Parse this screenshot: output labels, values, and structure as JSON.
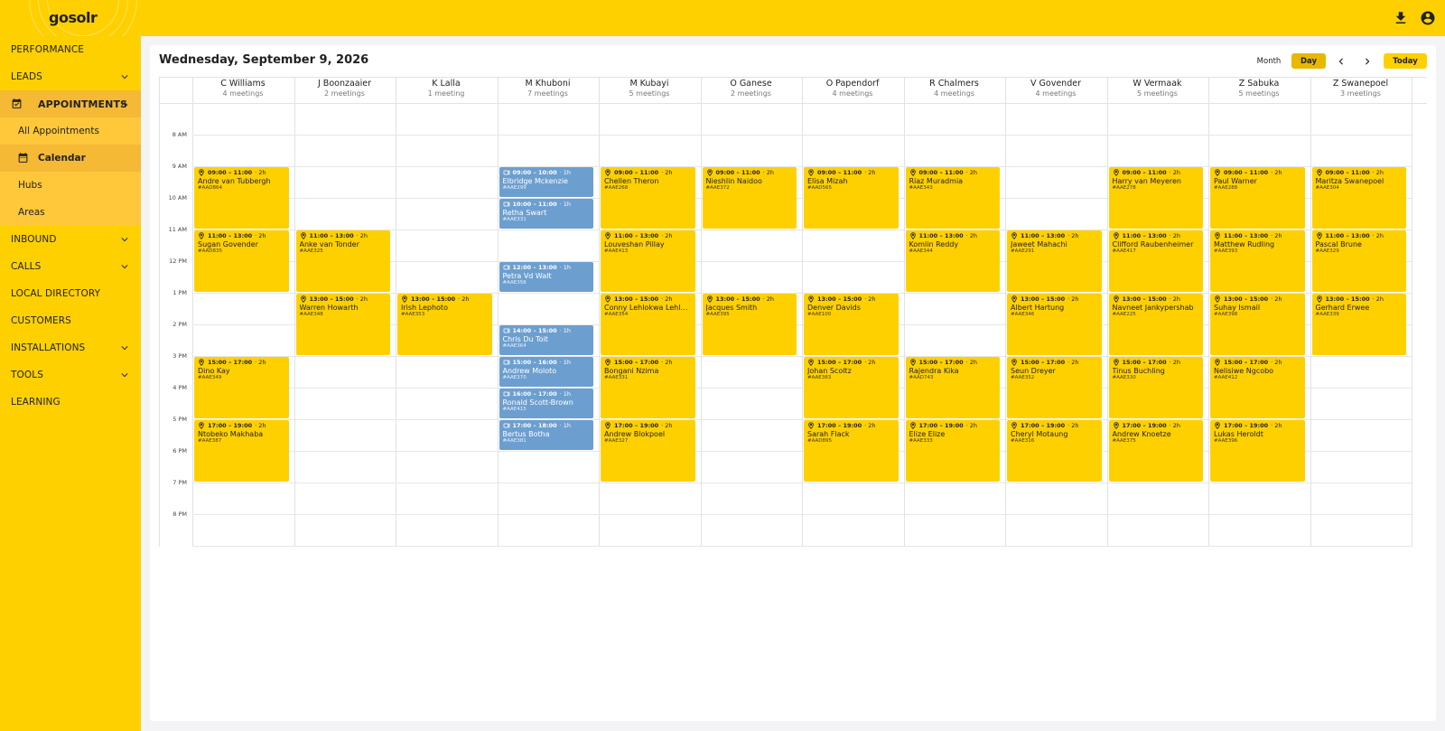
{
  "app": {
    "logo": "gosolr"
  },
  "topbar": {
    "download_icon": "download-icon",
    "account_icon": "account-circle-icon"
  },
  "sidebar": {
    "items": [
      {
        "label": "PERFORMANCE",
        "has_chevron": false
      },
      {
        "label": "LEADS",
        "has_chevron": true
      },
      {
        "label": "APPOINTMENTS",
        "has_chevron": true,
        "expanded": true
      },
      {
        "label": "INBOUND",
        "has_chevron": true
      },
      {
        "label": "CALLS",
        "has_chevron": true
      },
      {
        "label": "LOCAL DIRECTORY",
        "has_chevron": false
      },
      {
        "label": "CUSTOMERS",
        "has_chevron": false
      },
      {
        "label": "INSTALLATIONS",
        "has_chevron": true
      },
      {
        "label": "TOOLS",
        "has_chevron": true
      },
      {
        "label": "LEARNING",
        "has_chevron": false
      }
    ],
    "appointments_sub": [
      "All Appointments",
      "Calendar",
      "Hubs",
      "Areas"
    ]
  },
  "header": {
    "date": "Wednesday, September 9, 2026"
  },
  "controls": {
    "month": "Month",
    "day": "Day",
    "today": "Today"
  },
  "calendar": {
    "times": [
      "8 AM",
      "9 AM",
      "10 AM",
      "11 AM",
      "12 PM",
      "1 PM",
      "2 PM",
      "3 PM",
      "4 PM",
      "5 PM",
      "6 PM",
      "7 PM",
      "8 PM"
    ],
    "colors": {
      "field": "#FFD000",
      "virtual": "#6C9FD0"
    },
    "columns": [
      {
        "name": "C Williams",
        "count": "4 meetings",
        "events": [
          {
            "time": "09:00 – 11:00",
            "dur": "· 2h",
            "name": "Andre van Tubbergh",
            "ref": "#AAD864",
            "type": "field",
            "start": 9,
            "end": 11
          },
          {
            "time": "11:00 – 13:00",
            "dur": "· 2h",
            "name": "Sugan Govender",
            "ref": "#AAD835",
            "type": "field",
            "start": 11,
            "end": 13
          },
          {
            "time": "15:00 – 17:00",
            "dur": "· 2h",
            "name": "Dino Kay",
            "ref": "#AAE349",
            "type": "field",
            "start": 15,
            "end": 17
          },
          {
            "time": "17:00 – 19:00",
            "dur": "· 2h",
            "name": "Ntobeko Makhaba",
            "ref": "#AAE387",
            "type": "field",
            "start": 17,
            "end": 19
          }
        ]
      },
      {
        "name": "J Boonzaaier",
        "count": "2 meetings",
        "events": [
          {
            "time": "11:00 – 13:00",
            "dur": "· 2h",
            "name": "Anke van Tonder",
            "ref": "#AAE325",
            "type": "field",
            "start": 11,
            "end": 13
          },
          {
            "time": "13:00 – 15:00",
            "dur": "· 2h",
            "name": "Warren Howarth",
            "ref": "#AAE348",
            "type": "field",
            "start": 13,
            "end": 15
          }
        ]
      },
      {
        "name": "K Lalla",
        "count": "1 meeting",
        "events": [
          {
            "time": "13:00 – 15:00",
            "dur": "· 2h",
            "name": "Irish Lephoto",
            "ref": "#AAE353",
            "type": "field",
            "start": 13,
            "end": 15
          }
        ]
      },
      {
        "name": "M Khuboni",
        "count": "7 meetings",
        "events": [
          {
            "time": "09:00 – 10:00",
            "dur": "· 1h",
            "name": "Elbridge Mckenzie",
            "ref": "#AAE299",
            "type": "virtual",
            "start": 9,
            "end": 10
          },
          {
            "time": "10:00 – 11:00",
            "dur": "· 1h",
            "name": "Retha Swart",
            "ref": "#AAE331",
            "type": "virtual",
            "start": 10,
            "end": 11
          },
          {
            "time": "12:00 – 13:00",
            "dur": "· 1h",
            "name": "Petra Vd Walt",
            "ref": "#AAE356",
            "type": "virtual",
            "start": 12,
            "end": 13
          },
          {
            "time": "14:00 – 15:00",
            "dur": "· 1h",
            "name": "Chris Du Toit",
            "ref": "#AAE364",
            "type": "virtual",
            "start": 14,
            "end": 15
          },
          {
            "time": "15:00 – 16:00",
            "dur": "· 1h",
            "name": "Andrew Moloto",
            "ref": "#AAE370",
            "type": "virtual",
            "start": 15,
            "end": 16
          },
          {
            "time": "16:00 – 17:00",
            "dur": "· 1h",
            "name": "Ronald Scott-Brown",
            "ref": "#AAE415",
            "type": "virtual",
            "start": 16,
            "end": 17
          },
          {
            "time": "17:00 – 18:00",
            "dur": "· 1h",
            "name": "Bertus Botha",
            "ref": "#AAE381",
            "type": "virtual",
            "start": 17,
            "end": 18
          }
        ]
      },
      {
        "name": "M Kubayi",
        "count": "5 meetings",
        "events": [
          {
            "time": "09:00 – 11:00",
            "dur": "· 2h",
            "name": "Chellen Theron",
            "ref": "#AAE268",
            "type": "field",
            "start": 9,
            "end": 11
          },
          {
            "time": "11:00 – 13:00",
            "dur": "· 2h",
            "name": "Louveshan Pillay",
            "ref": "#AAE413",
            "type": "field",
            "start": 11,
            "end": 13
          },
          {
            "time": "13:00 – 15:00",
            "dur": "· 2h",
            "name": "Conny Lehlokwa Lehlokwa",
            "ref": "#AAE354",
            "type": "field",
            "start": 13,
            "end": 15
          },
          {
            "time": "15:00 – 17:00",
            "dur": "· 2h",
            "name": "Bongani Nzima",
            "ref": "#AAE331",
            "type": "field",
            "start": 15,
            "end": 17
          },
          {
            "time": "17:00 – 19:00",
            "dur": "· 2h",
            "name": "Andrew Blokpoel",
            "ref": "#AAE327",
            "type": "field",
            "start": 17,
            "end": 19
          }
        ]
      },
      {
        "name": "O Ganese",
        "count": "2 meetings",
        "events": [
          {
            "time": "09:00 – 11:00",
            "dur": "· 2h",
            "name": "Nieshlin Naidoo",
            "ref": "#AAE372",
            "type": "field",
            "start": 9,
            "end": 11
          },
          {
            "time": "13:00 – 15:00",
            "dur": "· 2h",
            "name": "Jacques Smith",
            "ref": "#AAE395",
            "type": "field",
            "start": 13,
            "end": 15
          }
        ]
      },
      {
        "name": "O Papendorf",
        "count": "4 meetings",
        "events": [
          {
            "time": "09:00 – 11:00",
            "dur": "· 2h",
            "name": "Elisa Mizah",
            "ref": "#AAD565",
            "type": "field",
            "start": 9,
            "end": 11
          },
          {
            "time": "13:00 – 15:00",
            "dur": "· 2h",
            "name": "Denver Davids",
            "ref": "#AAE100",
            "type": "field",
            "start": 13,
            "end": 15
          },
          {
            "time": "15:00 – 17:00",
            "dur": "· 2h",
            "name": "Johan Scoltz",
            "ref": "#AAE383",
            "type": "field",
            "start": 15,
            "end": 17
          },
          {
            "time": "17:00 – 19:00",
            "dur": "· 2h",
            "name": "Sarah Flack",
            "ref": "#AAD895",
            "type": "field",
            "start": 17,
            "end": 19
          }
        ]
      },
      {
        "name": "R Chalmers",
        "count": "4 meetings",
        "events": [
          {
            "time": "09:00 – 11:00",
            "dur": "· 2h",
            "name": "Riaz Muradmia",
            "ref": "#AAE343",
            "type": "field",
            "start": 9,
            "end": 11
          },
          {
            "time": "11:00 – 13:00",
            "dur": "· 2h",
            "name": "Komlin Reddy",
            "ref": "#AAE344",
            "type": "field",
            "start": 11,
            "end": 13
          },
          {
            "time": "15:00 – 17:00",
            "dur": "· 2h",
            "name": "Rajendra Kika",
            "ref": "#AAD743",
            "type": "field",
            "start": 15,
            "end": 17
          },
          {
            "time": "17:00 – 19:00",
            "dur": "· 2h",
            "name": "Elize Elize",
            "ref": "#AAE333",
            "type": "field",
            "start": 17,
            "end": 19
          }
        ]
      },
      {
        "name": "V Govender",
        "count": "4 meetings",
        "events": [
          {
            "time": "11:00 – 13:00",
            "dur": "· 2h",
            "name": "Jaweet Mahachi",
            "ref": "#AAE291",
            "type": "field",
            "start": 11,
            "end": 13
          },
          {
            "time": "13:00 – 15:00",
            "dur": "· 2h",
            "name": "Albert Hartung",
            "ref": "#AAE346",
            "type": "field",
            "start": 13,
            "end": 15
          },
          {
            "time": "15:00 – 17:00",
            "dur": "· 2h",
            "name": "Seun Dreyer",
            "ref": "#AAE352",
            "type": "field",
            "start": 15,
            "end": 17
          },
          {
            "time": "17:00 – 19:00",
            "dur": "· 2h",
            "name": "Cheryl Motaung",
            "ref": "#AAE316",
            "type": "field",
            "start": 17,
            "end": 19
          }
        ]
      },
      {
        "name": "W Vermaak",
        "count": "5 meetings",
        "events": [
          {
            "time": "09:00 – 11:00",
            "dur": "· 2h",
            "name": "Harry van Meyeren",
            "ref": "#AAE278",
            "type": "field",
            "start": 9,
            "end": 11
          },
          {
            "time": "11:00 – 13:00",
            "dur": "· 2h",
            "name": "Clifford Raubenheimer",
            "ref": "#AAE417",
            "type": "field",
            "start": 11,
            "end": 13
          },
          {
            "time": "13:00 – 15:00",
            "dur": "· 2h",
            "name": "Navneet Jankypershab",
            "ref": "#AAE225",
            "type": "field",
            "start": 13,
            "end": 15
          },
          {
            "time": "15:00 – 17:00",
            "dur": "· 2h",
            "name": "Tinus Buchling",
            "ref": "#AAE330",
            "type": "field",
            "start": 15,
            "end": 17
          },
          {
            "time": "17:00 – 19:00",
            "dur": "· 2h",
            "name": "Andrew Knoetze",
            "ref": "#AAE375",
            "type": "field",
            "start": 17,
            "end": 19
          }
        ]
      },
      {
        "name": "Z Sabuka",
        "count": "5 meetings",
        "events": [
          {
            "time": "09:00 – 11:00",
            "dur": "· 2h",
            "name": "Paul Warner",
            "ref": "#AAE288",
            "type": "field",
            "start": 9,
            "end": 11
          },
          {
            "time": "11:00 – 13:00",
            "dur": "· 2h",
            "name": "Matthew Rudling",
            "ref": "#AAE393",
            "type": "field",
            "start": 11,
            "end": 13
          },
          {
            "time": "13:00 – 15:00",
            "dur": "· 2h",
            "name": "Suhay Ismail",
            "ref": "#AAE398",
            "type": "field",
            "start": 13,
            "end": 15
          },
          {
            "time": "15:00 – 17:00",
            "dur": "· 2h",
            "name": "Nelisiwe Ngcobo",
            "ref": "#AAE412",
            "type": "field",
            "start": 15,
            "end": 17
          },
          {
            "time": "17:00 – 19:00",
            "dur": "· 2h",
            "name": "Lukas Heroldt",
            "ref": "#AAE396",
            "type": "field",
            "start": 17,
            "end": 19
          }
        ]
      },
      {
        "name": "Z Swanepoel",
        "count": "3 meetings",
        "events": [
          {
            "time": "09:00 – 11:00",
            "dur": "· 2h",
            "name": "Maritza Swanepoel",
            "ref": "#AAE304",
            "type": "field",
            "start": 9,
            "end": 11
          },
          {
            "time": "11:00 – 13:00",
            "dur": "· 2h",
            "name": "Pascal Brune",
            "ref": "#AAE329",
            "type": "field",
            "start": 11,
            "end": 13
          },
          {
            "time": "13:00 – 15:00",
            "dur": "· 2h",
            "name": "Gerhard Erwee",
            "ref": "#AAE339",
            "type": "field",
            "start": 13,
            "end": 15
          }
        ]
      }
    ]
  }
}
